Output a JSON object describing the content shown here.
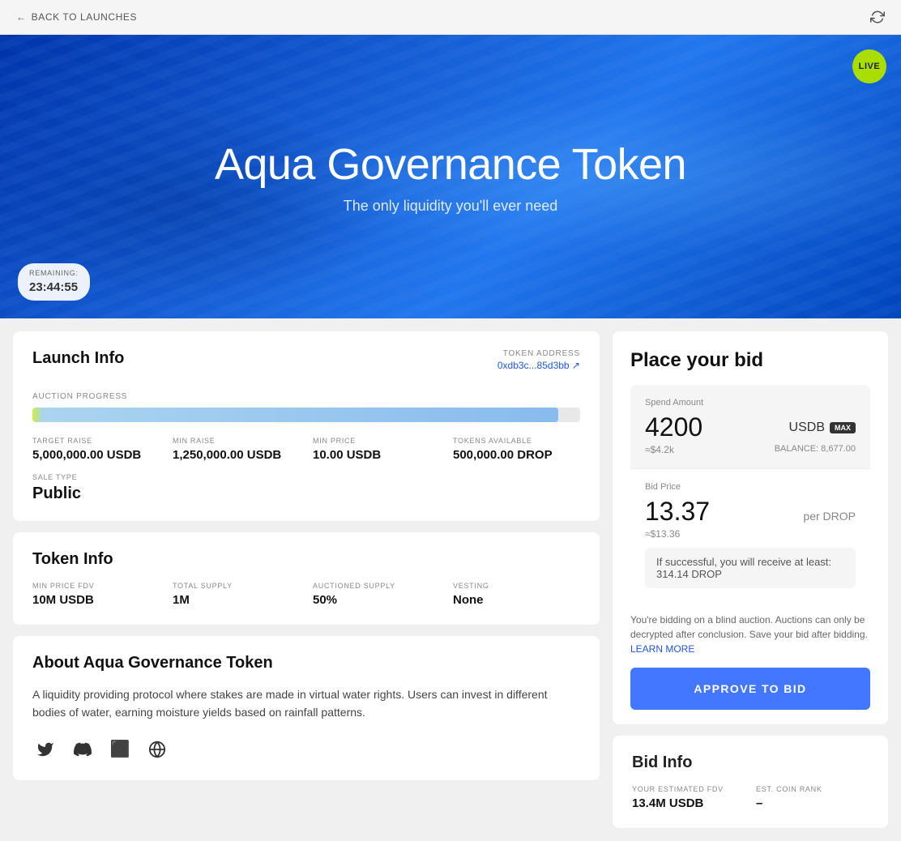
{
  "topBar": {
    "backLabel": "BACK TO LAUNCHES",
    "refreshIconLabel": "refresh"
  },
  "hero": {
    "liveBadge": "LIVE",
    "title": "Aqua Governance Token",
    "subtitle": "The only liquidity you'll ever need",
    "remaining": {
      "label": "REMAINING:",
      "time": "23:44:55"
    }
  },
  "launchInfo": {
    "cardTitle": "Launch Info",
    "tokenAddress": {
      "label": "TOKEN ADDRESS",
      "value": "0xdb3c...85d3bb ↗"
    },
    "auctionProgressLabel": "AUCTION PROGRESS",
    "progressPercent": 96,
    "stats": [
      {
        "label": "TARGET RAISE",
        "value": "5,000,000.00 USDB"
      },
      {
        "label": "MIN RAISE",
        "value": "1,250,000.00 USDB"
      },
      {
        "label": "MIN PRICE",
        "value": "10.00 USDB"
      },
      {
        "label": "TOKENS AVAILABLE",
        "value": "500,000.00 DROP"
      }
    ],
    "saleType": {
      "label": "SALE TYPE",
      "value": "Public"
    }
  },
  "tokenInfo": {
    "cardTitle": "Token Info",
    "stats": [
      {
        "label": "MIN PRICE FDV",
        "value": "10M USDB"
      },
      {
        "label": "TOTAL SUPPLY",
        "value": "1M"
      },
      {
        "label": "AUCTIONED SUPPLY",
        "value": "50%"
      },
      {
        "label": "VESTING",
        "value": "None"
      }
    ]
  },
  "about": {
    "cardTitle": "About Aqua Governance Token",
    "description": "A liquidity providing protocol where stakes are made in virtual water rights. Users can invest in different bodies of water, earning moisture yields based on rainfall patterns.",
    "socials": [
      {
        "name": "twitter",
        "icon": "🐦"
      },
      {
        "name": "discord",
        "icon": "💬"
      },
      {
        "name": "noun",
        "icon": "⬛"
      },
      {
        "name": "globe",
        "icon": "🌐"
      }
    ]
  },
  "placeBid": {
    "title": "Place your bid",
    "spendAmount": {
      "label": "Spend Amount",
      "value": "4200",
      "currency": "USDB",
      "maxLabel": "MAX",
      "usdEquiv": "≈$4.2k",
      "balance": "BALANCE: 8,677.00"
    },
    "bidPrice": {
      "label": "Bid Price",
      "value": "13.37",
      "unit": "per DROP",
      "usdEquiv": "≈$13.36",
      "receiveText": "If successful, you will receive at least: 314.14 DROP"
    },
    "blindAuctionText": "You're bidding on a blind auction. Auctions can only be decrypted after conclusion. Save your bid after bidding.",
    "learnMoreLabel": "LEARN MORE",
    "approveButtonLabel": "APPROVE TO BID"
  },
  "bidInfo": {
    "title": "Bid Info",
    "items": [
      {
        "label": "YOUR ESTIMATED FDV",
        "value": "13.4M USDB"
      },
      {
        "label": "EST. COIN RANK",
        "value": "–"
      }
    ]
  }
}
